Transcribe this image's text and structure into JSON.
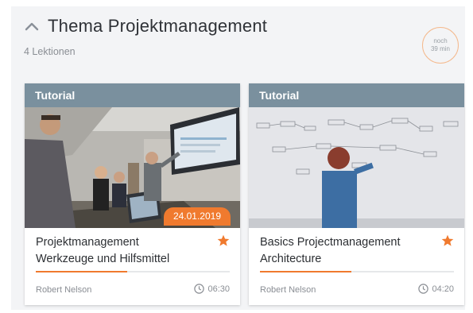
{
  "section": {
    "title": "Thema Projektmanagement",
    "lesson_count": "4 Lektionen",
    "remaining_line1": "noch",
    "remaining_line2": "39 min",
    "icon": "chevron-up-icon"
  },
  "colors": {
    "accent": "#f07a2e",
    "card_header": "#7a909e",
    "panel_bg": "#f3f4f6"
  },
  "cards": [
    {
      "type": "Tutorial",
      "date": "24.01.2019",
      "title_line1": "Projektmanagement",
      "title_line2": "Werkzeuge und Hilfsmittel",
      "author": "Robert Nelson",
      "duration": "06:30",
      "progress": 0.47,
      "favorite": true,
      "image": "meeting-room-photo"
    },
    {
      "type": "Tutorial",
      "title_line1": "Basics Projectmanagement",
      "title_line2": "Architecture",
      "author": "Robert Nelson",
      "duration": "04:20",
      "progress": 0.47,
      "favorite": true,
      "image": "whiteboard-photo"
    }
  ]
}
